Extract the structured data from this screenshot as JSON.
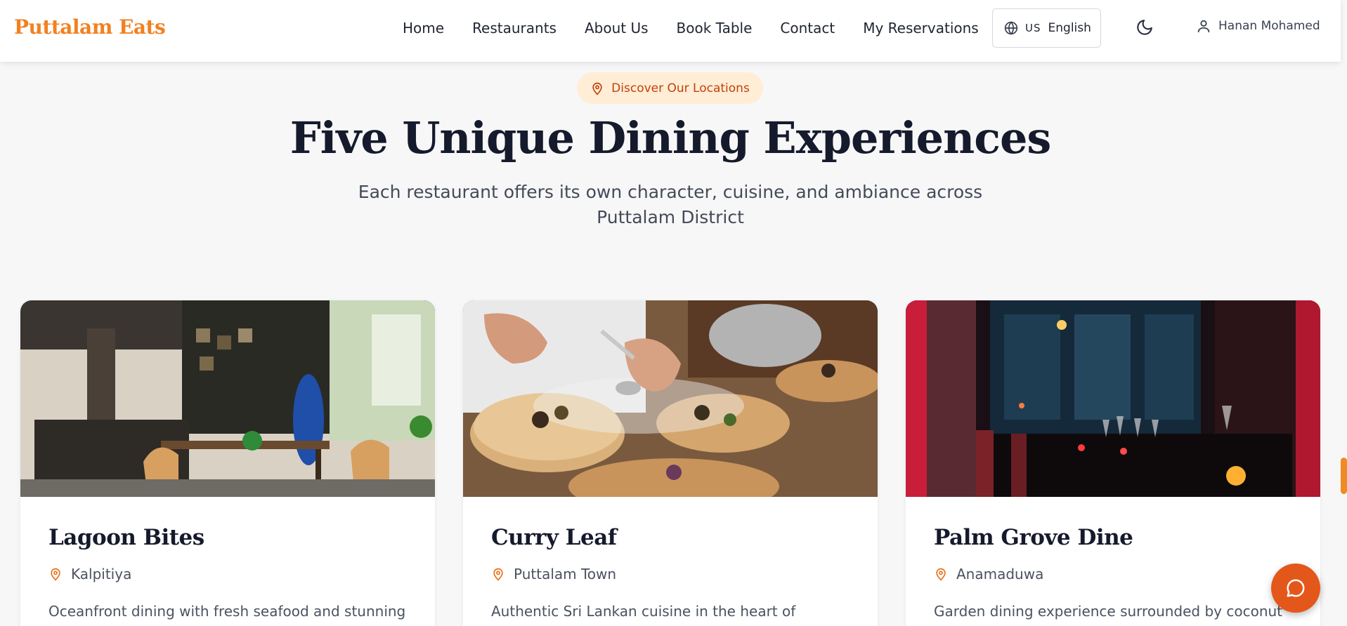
{
  "brand": {
    "name": "Puttalam Eats",
    "color": "#f2801f"
  },
  "nav": {
    "items": [
      {
        "label": "Home"
      },
      {
        "label": "Restaurants"
      },
      {
        "label": "About Us"
      },
      {
        "label": "Book Table"
      },
      {
        "label": "Contact"
      },
      {
        "label": "My Reservations"
      }
    ]
  },
  "language": {
    "icon": "globe-icon",
    "flag": "US",
    "label": "English"
  },
  "theme_toggle": {
    "icon": "moon-icon"
  },
  "user": {
    "icon": "user-icon",
    "name": "Hanan Mohamed"
  },
  "hero": {
    "pill_icon": "map-pin-icon",
    "pill_label": "Discover Our Locations",
    "title": "Five Unique Dining Experiences",
    "subtitle": "Each restaurant offers its own character, cuisine, and ambiance across Puttalam District"
  },
  "cards": [
    {
      "name": "Lagoon Bites",
      "location": "Kalpitiya",
      "description": "Oceanfront dining with fresh seafood and stunning"
    },
    {
      "name": "Curry Leaf",
      "location": "Puttalam Town",
      "description": "Authentic Sri Lankan cuisine in the heart of Puttalam"
    },
    {
      "name": "Palm Grove Dine",
      "location": "Anamaduwa",
      "description": "Garden dining experience surrounded by coconut"
    }
  ],
  "chat": {
    "icon": "chat-bubble-icon"
  },
  "colors": {
    "accent": "#f2801f",
    "pill_bg": "#ffedd5",
    "pill_text": "#c2410c",
    "chat": "#e4571a",
    "heading": "#151a2c"
  }
}
